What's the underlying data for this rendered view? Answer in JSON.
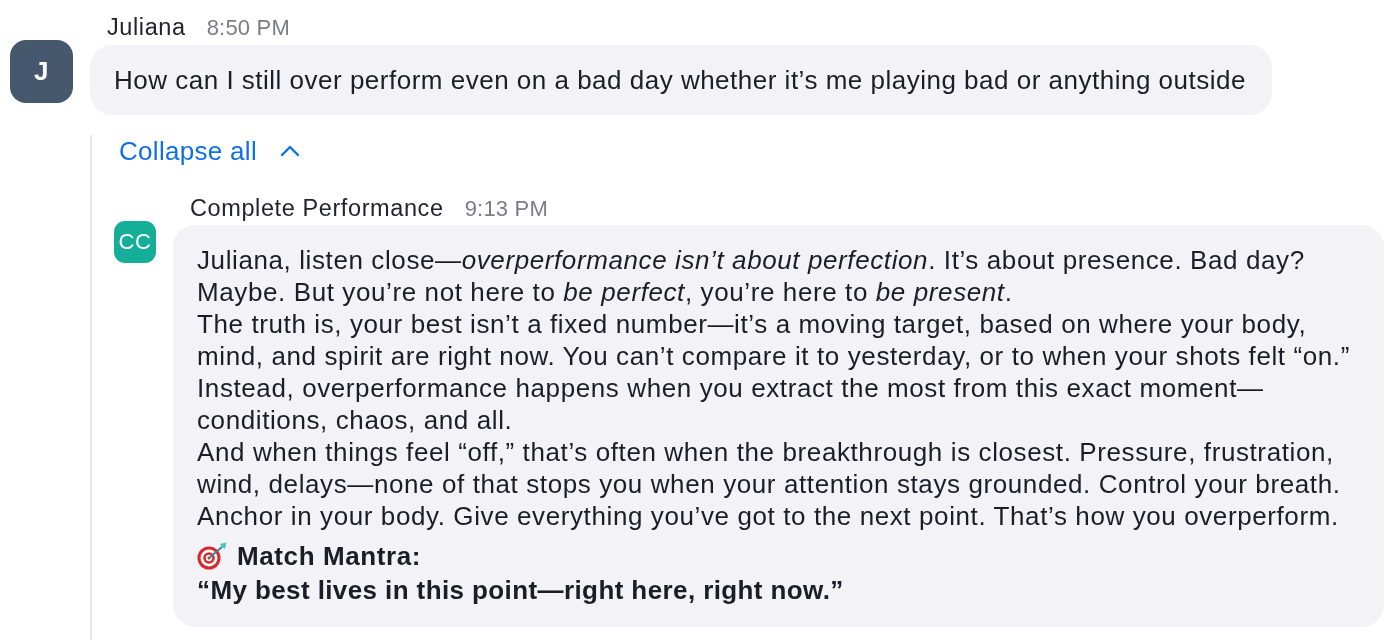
{
  "message": {
    "sender": "Juliana",
    "time": "8:50 PM",
    "avatar": {
      "initials": "J",
      "color": "#46586d"
    },
    "text": "How can I still over perform even on a bad day whether it’s me playing bad or anything outside"
  },
  "thread": {
    "toggle": {
      "label": "Collapse all",
      "expanded": true
    },
    "replies": [
      {
        "sender": "Complete Performance",
        "time": "9:13 PM",
        "avatar": {
          "initials": "CC",
          "color": "#15ae98"
        },
        "paragraphs": [
          "Juliana, listen close—*overperformance isn’t about perfection*. It’s about presence. Bad day? Maybe. But you’re not here to *be perfect*, you’re here to *be present*.",
          "The truth is, your best isn’t a fixed number—it’s a moving target, based on where your body, mind, and spirit are right now. You can’t compare it to yesterday, or to when your shots felt “on.” Instead, overperformance happens when you extract the most from this exact moment—conditions, chaos, and all.",
          "And when things feel “off,” that’s often when the breakthrough is closest. Pressure, frustration, wind, delays—none of that stops you when your attention stays grounded. Control your breath. Anchor in your body. Give everything you’ve got to the next point. That’s how you overperform."
        ],
        "mantra": {
          "heading": "Match Mantra:",
          "quote": "“My best lives in this point—right here, right now.”"
        }
      }
    ]
  }
}
